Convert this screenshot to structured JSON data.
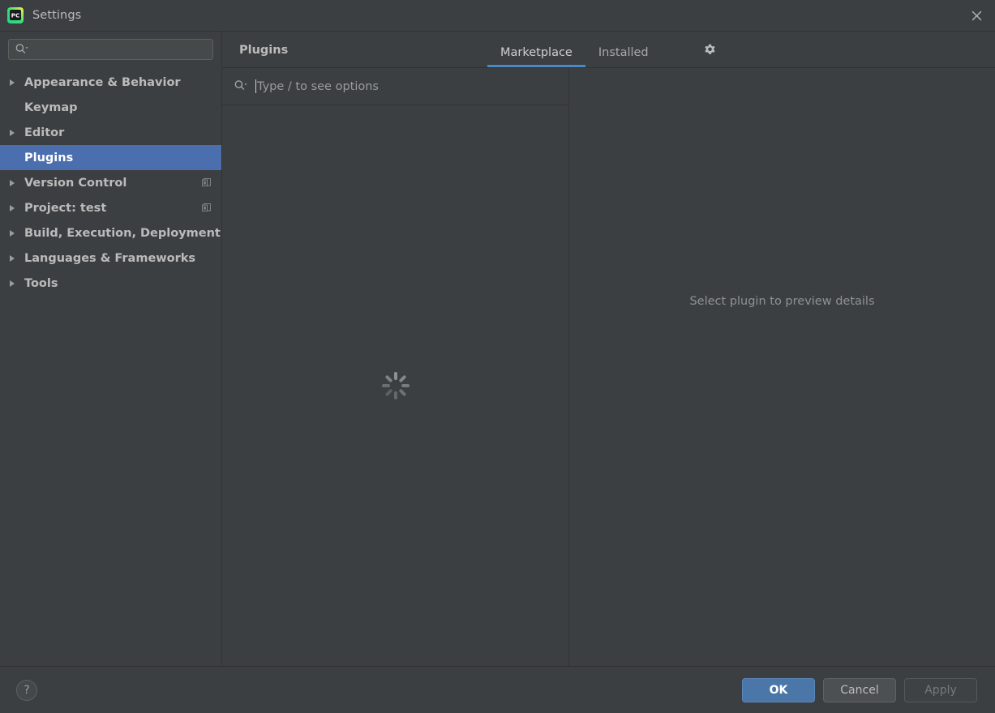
{
  "window": {
    "title": "Settings",
    "app_icon": "pycharm-logo-icon",
    "close_icon": "close-icon"
  },
  "sidebar": {
    "search": {
      "placeholder": "",
      "value": "",
      "icon": "search-icon"
    },
    "items": [
      {
        "label": "Appearance & Behavior",
        "expandable": true,
        "selected": false,
        "badge": null
      },
      {
        "label": "Keymap",
        "expandable": false,
        "selected": false,
        "badge": null
      },
      {
        "label": "Editor",
        "expandable": true,
        "selected": false,
        "badge": null
      },
      {
        "label": "Plugins",
        "expandable": false,
        "selected": true,
        "badge": null
      },
      {
        "label": "Version Control",
        "expandable": true,
        "selected": false,
        "badge": "project-settings-icon"
      },
      {
        "label": "Project: test",
        "expandable": true,
        "selected": false,
        "badge": "project-settings-icon"
      },
      {
        "label": "Build, Execution, Deployment",
        "expandable": true,
        "selected": false,
        "badge": null
      },
      {
        "label": "Languages & Frameworks",
        "expandable": true,
        "selected": false,
        "badge": null
      },
      {
        "label": "Tools",
        "expandable": true,
        "selected": false,
        "badge": null
      }
    ]
  },
  "main": {
    "title": "Plugins",
    "tabs": [
      {
        "label": "Marketplace",
        "active": true
      },
      {
        "label": "Installed",
        "active": false
      }
    ],
    "settings_icon": "gear-icon",
    "search": {
      "placeholder": "Type / to see options",
      "value": "",
      "icon": "search-icon"
    },
    "list": {
      "state": "loading",
      "loading_icon": "spinner-icon"
    },
    "detail": {
      "empty_text": "Select plugin to preview details"
    }
  },
  "footer": {
    "help_label": "?",
    "buttons": [
      {
        "label": "OK",
        "style": "primary"
      },
      {
        "label": "Cancel",
        "style": "normal"
      },
      {
        "label": "Apply",
        "style": "disabled"
      }
    ]
  },
  "colors": {
    "window_bg": "#3c3f41",
    "selection_blue": "#4b6eaf",
    "tab_underline": "#4a88c7",
    "primary_button": "#4a76a8",
    "text": "#bbbbbb",
    "muted_text": "#8f9193",
    "border": "#323232"
  }
}
